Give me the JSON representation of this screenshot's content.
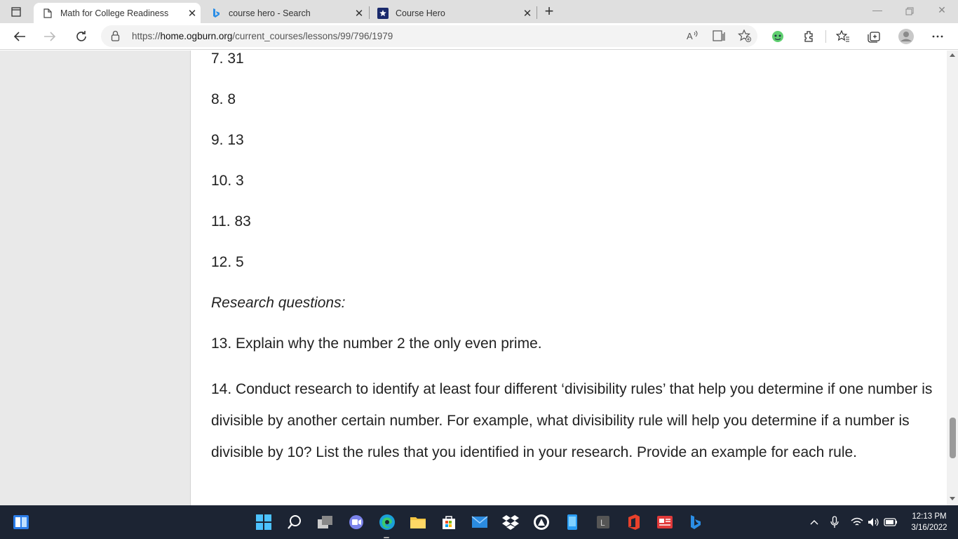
{
  "browser": {
    "tabs": [
      {
        "title": "Math for College Readiness",
        "active": true
      },
      {
        "title": "course hero - Search",
        "active": false
      },
      {
        "title": "Course Hero",
        "active": false
      }
    ],
    "address": {
      "prefix": "https://",
      "host": "home.ogburn.org",
      "path": "/current_courses/lessons/99/796/1979"
    }
  },
  "page": {
    "items": [
      {
        "text": "7. 31"
      },
      {
        "text": "8. 8"
      },
      {
        "text": "9. 13"
      },
      {
        "text": "10. 3"
      },
      {
        "text": "11. 83"
      },
      {
        "text": "12. 5"
      }
    ],
    "research_heading": "Research questions:",
    "q13": "13. Explain why the number 2 the only even prime.",
    "q14": "14. Conduct research to identify at least four different ‘divisibility rules’ that help you determine if one number is divisible by another certain number. For example, what divisibility rule will help you determine if a number is divisible by 10? List the rules that you identified in your research. Provide an example for each rule."
  },
  "taskbar": {
    "time": "12:13 PM",
    "date": "3/16/2022"
  },
  "colors": {
    "accent": "#0078d4",
    "taskbar_bg": "#1c2433",
    "tabstrip_bg": "#dfdfdf"
  }
}
